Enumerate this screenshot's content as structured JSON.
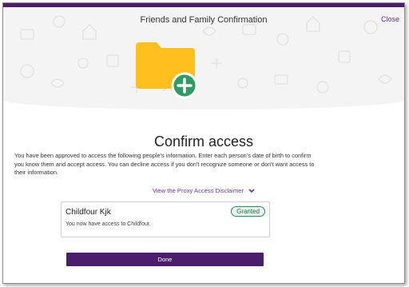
{
  "dialog": {
    "title": "Friends and Family Confirmation",
    "close_label": "Close"
  },
  "main": {
    "heading": "Confirm access",
    "intro": "You have been approved to access the following people's information. Enter each person's date of birth to confirm you know them and accept access. You can decline access if you don't recognize someone or don't want access to their information.",
    "disclaimer_link": "View the Proxy Access Disclaimer"
  },
  "people": [
    {
      "name": "Childfour Kjk",
      "status": "Granted",
      "message": "You now have access to Childfour."
    }
  ],
  "actions": {
    "done_label": "Done"
  },
  "colors": {
    "brand_purple": "#4b1d6b",
    "link_purple": "#6a3a8e",
    "folder_yellow": "#ffbf1f",
    "add_green": "#2e9b63",
    "granted_green": "#2e8b57"
  },
  "icons": {
    "header_illustration": "folder-add-icon",
    "disclaimer_toggle": "chevron-down-icon"
  }
}
